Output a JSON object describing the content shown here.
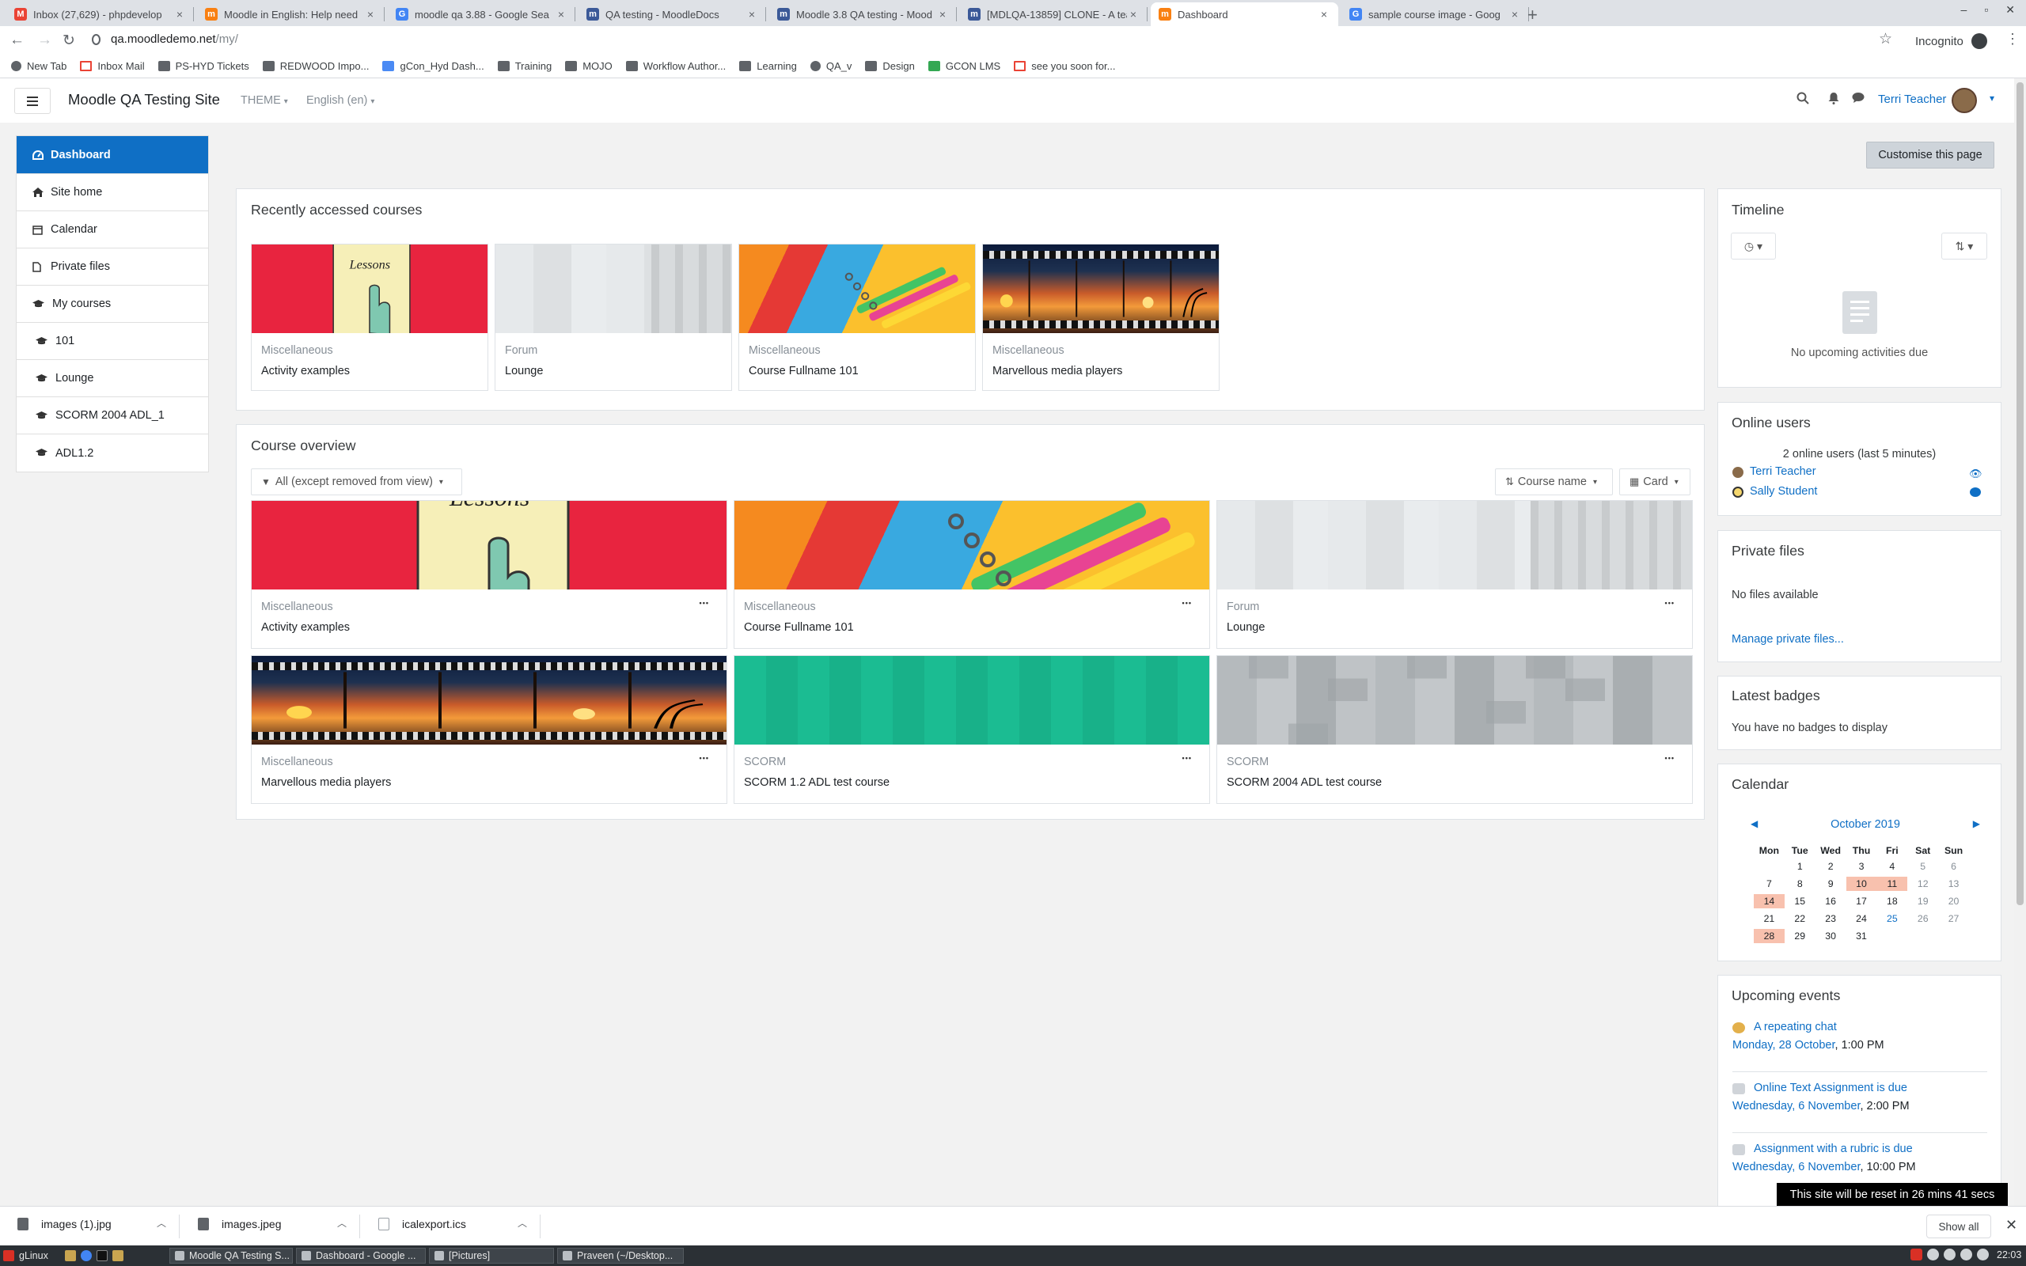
{
  "browser": {
    "tabs": [
      {
        "title": "Inbox (27,629) - phpdevelop",
        "fav": "M",
        "color": "#ea4335"
      },
      {
        "title": "Moodle in English: Help need",
        "fav": "m",
        "color": "#f98012"
      },
      {
        "title": "moodle qa 3.88 - Google Sea",
        "fav": "G",
        "color": "#4285f4"
      },
      {
        "title": "QA testing - MoodleDocs",
        "fav": "m",
        "color": "#3b5998"
      },
      {
        "title": "Moodle 3.8 QA testing - Mood",
        "fav": "m",
        "color": "#3b5998"
      },
      {
        "title": "[MDLQA-13859] CLONE - A tea",
        "fav": "m",
        "color": "#3b5998"
      },
      {
        "title": "Dashboard",
        "fav": "m",
        "color": "#f98012"
      },
      {
        "title": "sample course image - Goog",
        "fav": "G",
        "color": "#4285f4"
      }
    ],
    "new_tab": "+",
    "close": "×",
    "url_host": "qa.moodledemo.net",
    "url_path": "/my/",
    "incognito_label": "Incognito",
    "bookmarks": [
      {
        "label": "New Tab",
        "icon": "globe-icon"
      },
      {
        "label": "Inbox Mail",
        "icon": "gmail-icon"
      },
      {
        "label": "PS-HYD Tickets",
        "icon": "folder-icon"
      },
      {
        "label": "REDWOOD Impo...",
        "icon": "folder-icon"
      },
      {
        "label": "gCon_Hyd Dash...",
        "icon": "sheet-icon"
      },
      {
        "label": "Training",
        "icon": "folder-icon"
      },
      {
        "label": "MOJO",
        "icon": "folder-icon"
      },
      {
        "label": "Workflow Author...",
        "icon": "folder-icon"
      },
      {
        "label": "Learning",
        "icon": "folder-icon"
      },
      {
        "label": "QA_v",
        "icon": "globe-icon"
      },
      {
        "label": "Design",
        "icon": "folder-icon"
      },
      {
        "label": "GCON LMS",
        "icon": "classroom-icon"
      },
      {
        "label": "see you soon for...",
        "icon": "gmail-icon"
      }
    ]
  },
  "navbar": {
    "site_name": "Moodle QA Testing Site",
    "theme_label": "THEME",
    "language_label": "English (en)",
    "user_name": "Terri Teacher"
  },
  "nav": {
    "items": [
      {
        "label": "Dashboard",
        "icon": "dashboard-icon",
        "active": true
      },
      {
        "label": "Site home",
        "icon": "home-icon"
      },
      {
        "label": "Calendar",
        "icon": "calendar-icon"
      },
      {
        "label": "Private files",
        "icon": "file-icon"
      },
      {
        "label": "My courses",
        "icon": "graduation-cap-icon"
      },
      {
        "label": "101",
        "icon": "graduation-cap-icon",
        "sub": true
      },
      {
        "label": "Lounge",
        "icon": "graduation-cap-icon",
        "sub": true
      },
      {
        "label": "SCORM 2004 ADL_1",
        "icon": "graduation-cap-icon",
        "sub": true
      },
      {
        "label": "ADL1.2",
        "icon": "graduation-cap-icon",
        "sub": true
      }
    ]
  },
  "main": {
    "customise_label": "Customise this page",
    "recent": {
      "title": "Recently accessed courses",
      "cards": [
        {
          "category": "Miscellaneous",
          "name": "Activity examples",
          "img": "red"
        },
        {
          "category": "Forum",
          "name": "Lounge",
          "img": "grey"
        },
        {
          "category": "Miscellaneous",
          "name": "Course Fullname 101",
          "img": "yellow"
        },
        {
          "category": "Miscellaneous",
          "name": "Marvellous media players",
          "img": "film"
        }
      ]
    },
    "overview": {
      "title": "Course overview",
      "filter_label": "All (except removed from view)",
      "sort_label": "Course name",
      "view_label": "Card",
      "menu_dots": "•••",
      "cards": [
        {
          "category": "Miscellaneous",
          "name": "Activity examples",
          "img": "red"
        },
        {
          "category": "Miscellaneous",
          "name": "Course Fullname 101",
          "img": "yellow"
        },
        {
          "category": "Forum",
          "name": "Lounge",
          "img": "grey"
        },
        {
          "category": "Miscellaneous",
          "name": "Marvellous media players",
          "img": "film"
        },
        {
          "category": "SCORM",
          "name": "SCORM 1.2 ADL test course",
          "img": "teal"
        },
        {
          "category": "SCORM",
          "name": "SCORM 2004 ADL test course",
          "img": "tiles"
        }
      ]
    }
  },
  "right": {
    "timeline": {
      "title": "Timeline",
      "empty": "No upcoming activities due"
    },
    "online": {
      "title": "Online users",
      "summary": "2 online users (last 5 minutes)",
      "users": [
        "Terri Teacher",
        "Sally Student"
      ]
    },
    "files": {
      "title": "Private files",
      "empty": "No files available",
      "manage": "Manage private files..."
    },
    "badges": {
      "title": "Latest badges",
      "empty": "You have no badges to display"
    },
    "calendar": {
      "title": "Calendar",
      "month": "October 2019",
      "prev": "◀",
      "next": "▶",
      "days_of_week": [
        "Mon",
        "Tue",
        "Wed",
        "Thu",
        "Fri",
        "Sat",
        "Sun"
      ],
      "start_offset": 1,
      "days_in_month": 31,
      "event_days": [
        10,
        11,
        14,
        28
      ],
      "linked_days": [
        25
      ]
    },
    "upcoming": {
      "title": "Upcoming events",
      "events": [
        {
          "name": "A repeating chat",
          "date": "Monday, 28 October",
          "time": ", 1:00 PM",
          "type": "chat"
        },
        {
          "name": "Online Text Assignment is due",
          "date": "Wednesday, 6 November",
          "time": ", 2:00 PM",
          "type": "assign"
        },
        {
          "name": "Assignment with a rubric is due",
          "date": "Wednesday, 6 November",
          "time": ", 10:00 PM",
          "type": "assign"
        }
      ]
    }
  },
  "reset_notice": "This site will be reset in 26 mins 41 secs",
  "downloads": {
    "items": [
      "images (1).jpg",
      "images.jpeg",
      "icalexport.ics"
    ],
    "show_all": "Show all"
  },
  "taskbar": {
    "start_label": "gLinux",
    "windows": [
      "Moodle QA Testing S...",
      "Dashboard - Google ...",
      "[Pictures]",
      "Praveen (~/Desktop..."
    ],
    "clock": "22:03"
  }
}
